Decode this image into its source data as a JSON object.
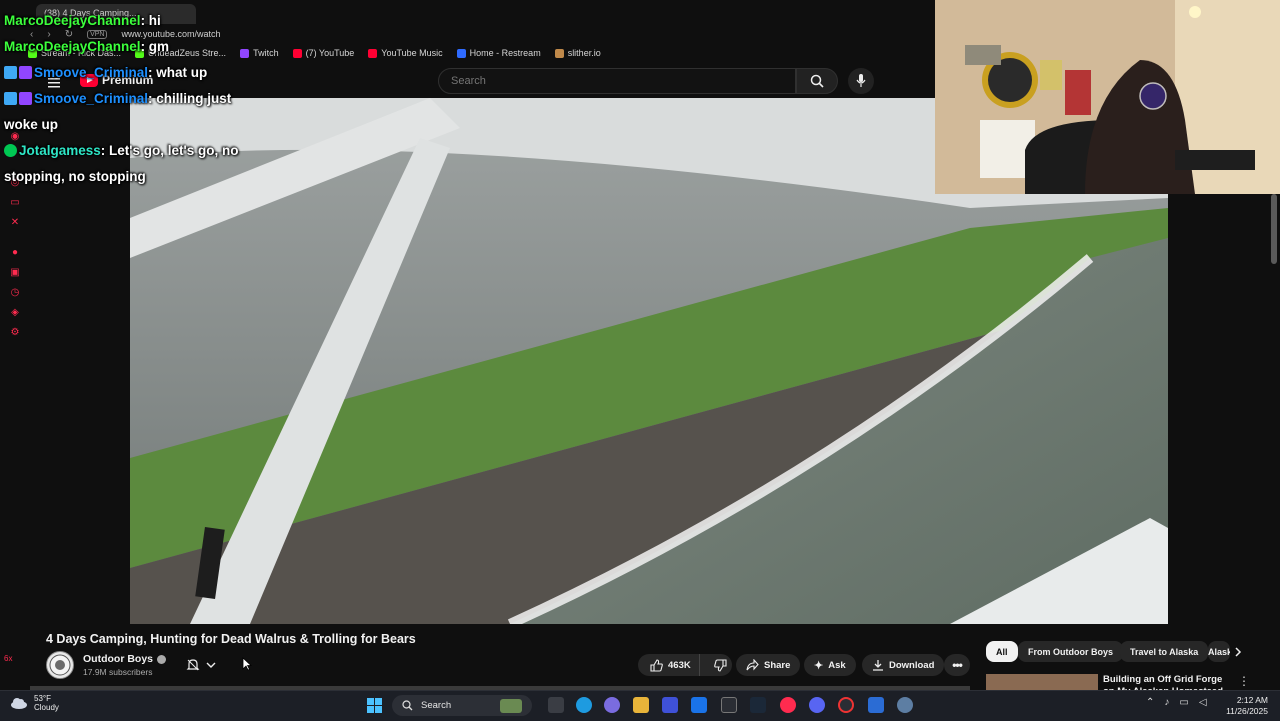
{
  "browser": {
    "tab_title": "(38) 4 Days Camping...",
    "url": "www.youtube.com/watch",
    "vpn_badge": "VPN",
    "bookmarks": [
      {
        "label": "Stream - Kick Das...",
        "color": "#53fc18"
      },
      {
        "label": "UndeadZeus Stre...",
        "color": "#53fc18"
      },
      {
        "label": "Twitch",
        "color": "#9146ff"
      },
      {
        "label": "(7) YouTube",
        "color": "#ff0033"
      },
      {
        "label": "YouTube Music",
        "color": "#ff0033"
      },
      {
        "label": "Home - Restream",
        "color": "#2f6bff"
      },
      {
        "label": "slither.io",
        "color": "#c0894a"
      }
    ]
  },
  "youtube": {
    "logo_text": "Premium",
    "search_placeholder": "Search"
  },
  "chat": [
    {
      "user": "MarcoDeejayChannel",
      "text": ": hi",
      "color": "green",
      "badges": 0
    },
    {
      "user": "MarcoDeejayChannel",
      "text": ": gm",
      "color": "green",
      "badges": 0
    },
    {
      "user": "Smoove_Criminal",
      "text": ": what up",
      "color": "blue",
      "badges": 2
    },
    {
      "user": "Smoove_Criminal",
      "text": ": chilling just woke up",
      "color": "blue",
      "badges": 2
    },
    {
      "user": "Jotalgamess",
      "text": ": Let's go, let's go, no stopping, no stopping",
      "color": "teal",
      "badges": 1
    }
  ],
  "video": {
    "title": "4 Days Camping, Hunting for Dead Walrus & Trolling for Bears",
    "channel": "Outdoor Boys",
    "subscribers": "17.9M subscribers",
    "likes": "463K",
    "share_label": "Share",
    "ask_label": "Ask",
    "download_label": "Download"
  },
  "chips": [
    "All",
    "From Outdoor Boys",
    "Travel to Alaska",
    "Alaska"
  ],
  "recommendation": {
    "title": "Building an Off Grid Forge on My Alaskan Homestead"
  },
  "taskbar": {
    "temperature": "53°F",
    "weather": "Cloudy",
    "search_label": "Search",
    "time": "2:12 AM",
    "date": "11/26/2025"
  },
  "sidebar_extra": "6x",
  "colors": {
    "youtube_red": "#ff0033",
    "chat_green": "#3cff3c",
    "chat_blue": "#1e90ff",
    "chat_teal": "#2ee6c6",
    "twitch_accent": "#ff2b4f"
  }
}
